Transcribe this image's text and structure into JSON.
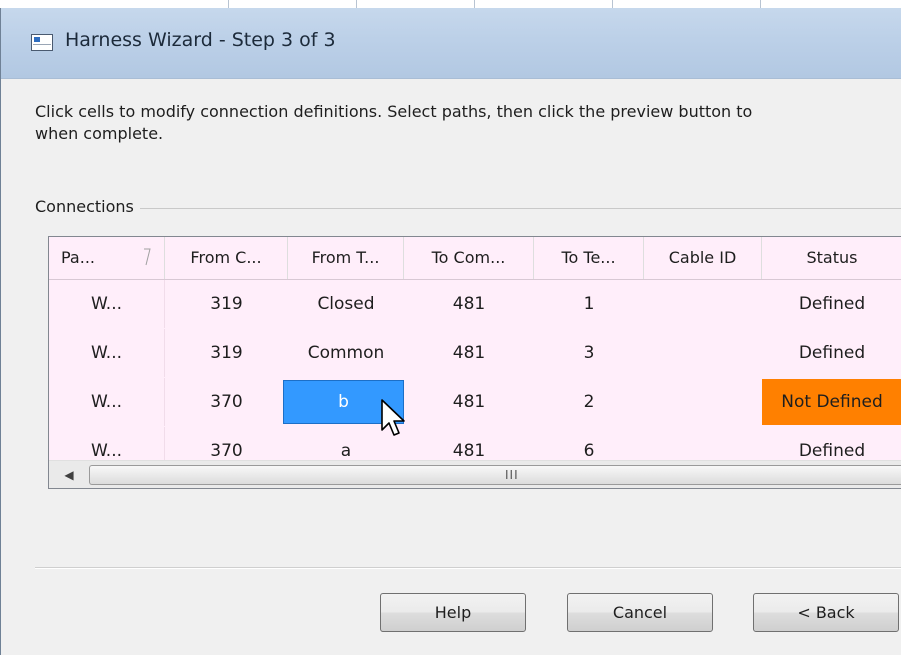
{
  "window": {
    "title": "Harness Wizard - Step 3 of 3",
    "icon": "app-window-icon"
  },
  "instruction": {
    "line1": "Click cells to modify connection definitions.  Select paths, then click the preview button to",
    "line2": "when complete."
  },
  "connections": {
    "group_label": "Connections",
    "columns": [
      "Pa...",
      "From C...",
      "From T...",
      "To Com...",
      "To Te...",
      "Cable ID",
      "Status"
    ],
    "rows": [
      {
        "path": "W...",
        "from_component": "319",
        "from_terminal": "Closed",
        "to_component": "481",
        "to_terminal": "1",
        "cable_id": "",
        "status": "Defined"
      },
      {
        "path": "W...",
        "from_component": "319",
        "from_terminal": "Common",
        "to_component": "481",
        "to_terminal": "3",
        "cable_id": "",
        "status": "Defined"
      },
      {
        "path": "W...",
        "from_component": "370",
        "from_terminal": "b",
        "to_component": "481",
        "to_terminal": "2",
        "cable_id": "",
        "status": "Not Defined"
      },
      {
        "path": "W...",
        "from_component": "370",
        "from_terminal": "a",
        "to_component": "481",
        "to_terminal": "6",
        "cable_id": "",
        "status": "Defined"
      }
    ],
    "selected_cell": {
      "row": 3,
      "column": "from_terminal"
    },
    "colors": {
      "row_background": "#ffeefa",
      "selected_cell": "#3399ff",
      "not_defined_status": "#ff8000"
    },
    "scrollbar": {
      "grip": "III",
      "left_arrow": "◀"
    }
  },
  "buttons": {
    "help": "Help",
    "cancel": "Cancel",
    "back": "< Back"
  }
}
